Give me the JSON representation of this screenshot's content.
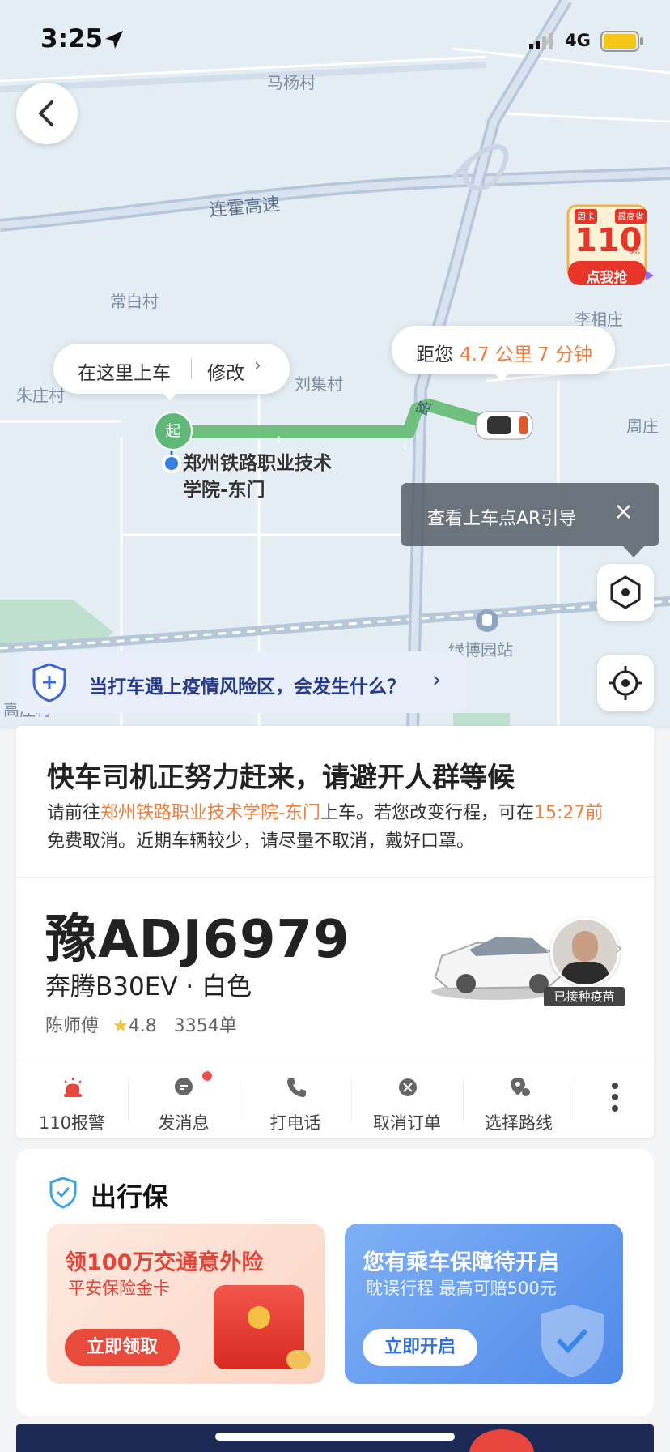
{
  "status_bar": {
    "time": "3:25",
    "network": "4G"
  },
  "map": {
    "labels": [
      {
        "id": "mayangcun",
        "text": "马杨村"
      },
      {
        "id": "lianhuo",
        "text": "连霍高速"
      },
      {
        "id": "changbaicun",
        "text": "常白村"
      },
      {
        "id": "lixiangzhuang",
        "text": "李相庄"
      },
      {
        "id": "zhuzhuangcun",
        "text": "朱庄村"
      },
      {
        "id": "liujicun",
        "text": "刘集村"
      },
      {
        "id": "zhouzhuang",
        "text": "周庄"
      },
      {
        "id": "road",
        "text": "路"
      },
      {
        "id": "lvboyuan",
        "text": "绿博园站"
      },
      {
        "id": "gaozhuang",
        "text": "高庄村"
      }
    ],
    "start_marker": "起",
    "pickup_point": "郑州铁路职业技术学院-东门"
  },
  "pickup_bubble": {
    "label": "在这里上车",
    "edit": "修改"
  },
  "distance_bubble": {
    "prefix": "距您",
    "distance": "4.7 公里",
    "time": "7 分钟"
  },
  "promo_badge": {
    "top_left": "周卡",
    "top_right": "最高省",
    "amount": "110",
    "unit": "元",
    "cta": "点我抢"
  },
  "ar_tip": {
    "text": "查看上车点AR引导"
  },
  "covid_banner": {
    "text": "当打车遇上疫情风险区，会发生什么？"
  },
  "order": {
    "title": "快车司机正努力赶来，请避开人群等候",
    "desc_prefix": "请前往",
    "desc_place": "郑州铁路职业技术学院-东门",
    "desc_mid": "上车。若您改变行程，可在",
    "desc_time": "15:27前",
    "desc_suffix": "免费取消。近期车辆较少，请尽量不取消，戴好口罩。"
  },
  "car": {
    "plate": "豫ADJ6979",
    "model": "奔腾B30EV · 白色",
    "driver_name": "陈师傅",
    "rating": "4.8",
    "orders": "3354单",
    "vaccine_badge": "已接种疫苗"
  },
  "actions": [
    {
      "id": "alarm",
      "label": "110报警"
    },
    {
      "id": "message",
      "label": "发消息"
    },
    {
      "id": "call",
      "label": "打电话"
    },
    {
      "id": "cancel",
      "label": "取消订单"
    },
    {
      "id": "route",
      "label": "选择路线"
    }
  ],
  "insurance": {
    "title": "出行保",
    "left": {
      "title": "领100万交通意外险",
      "subtitle": "平安保险金卡",
      "button": "立即领取"
    },
    "right": {
      "title": "您有乘车保障待开启",
      "subtitle": "耽误行程 最高可赔500元",
      "button": "立即开启"
    }
  },
  "colors": {
    "accent_orange": "#f07d3c",
    "route_green": "#6fbf7e",
    "banner_blue": "#253a8a"
  }
}
